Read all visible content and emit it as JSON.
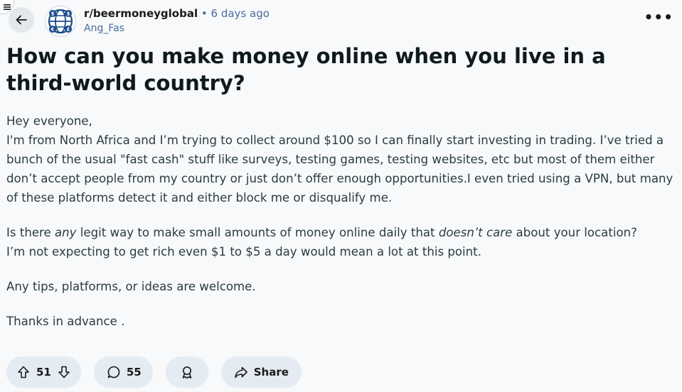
{
  "header": {
    "subreddit": "r/beermoneyglobal",
    "separator": "•",
    "time": "6 days ago",
    "author": "Ang_Fas",
    "more_label": "•••",
    "icons": {
      "menu": "menu-icon",
      "back": "arrow-left-icon",
      "avatar": "subreddit-avatar-icon",
      "more": "more-options-icon"
    }
  },
  "post": {
    "title": "How can you make money online when you live in a third-world country?",
    "greeting": "Hey everyone,",
    "para1": "I'm from North Africa and I’m trying to collect around $100 so I can finally start investing in trading. I’ve tried a bunch of the usual \"fast cash\" stuff like surveys, testing games, testing websites, etc but most of them either don’t accept people from my country or just don’t offer enough opportunities.I even tried using a VPN, but many of these platforms detect it and either block me or disqualify me.",
    "para2_pre": "Is there ",
    "para2_em1": "any",
    "para2_mid": " legit way to make small amounts of money online daily that ",
    "para2_em2": "doesn’t care",
    "para2_post": " about your location?",
    "para2_line2": "I’m not expecting to get rich even $1 to $5 a day would mean a lot at this point.",
    "para3": "Any tips, platforms, or ideas are welcome.",
    "para4": "Thanks in advance ."
  },
  "actions": {
    "votes": "51",
    "comments": "55",
    "share_label": "Share",
    "icons": {
      "upvote": "upvote-arrow-icon",
      "downvote": "downvote-arrow-icon",
      "comment": "comment-bubble-icon",
      "award": "award-icon",
      "share": "share-arrow-icon"
    }
  },
  "colors": {
    "background": "#f7f9fa",
    "pill": "#e4ebf2",
    "meta": "#4a6d9a",
    "avatar_blue": "#1a4a8a"
  }
}
